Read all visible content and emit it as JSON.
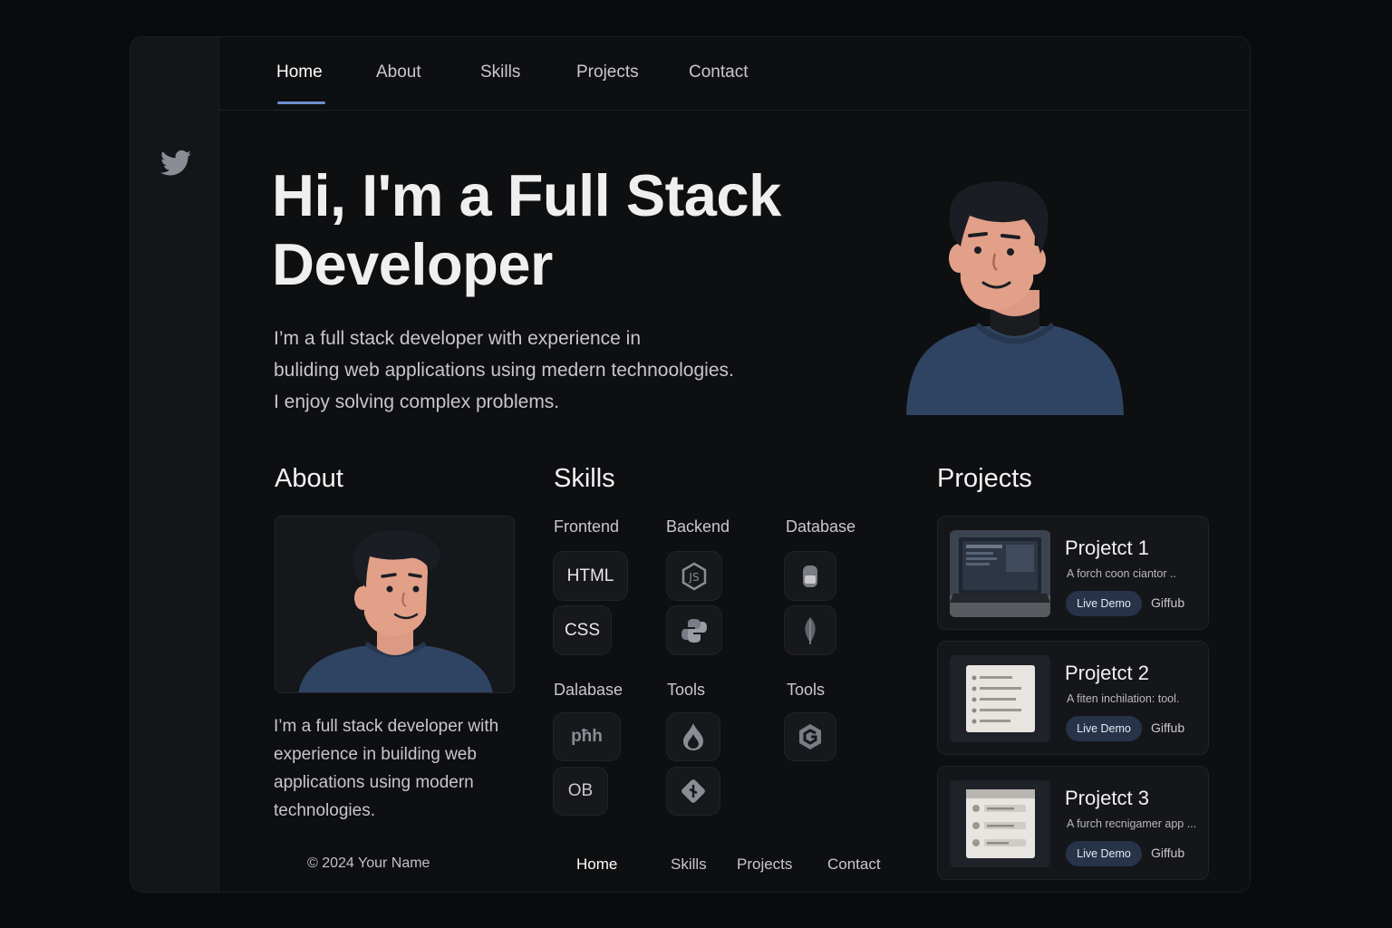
{
  "nav": {
    "items": [
      {
        "label": "Home",
        "active": true
      },
      {
        "label": "About"
      },
      {
        "label": "Skills"
      },
      {
        "label": "Projects"
      },
      {
        "label": "Contact"
      }
    ]
  },
  "sidebar": {
    "icon": "twitter-bird-icon"
  },
  "hero": {
    "title_line1": "Hi, I'm a Full Stack",
    "title_line2": "Developer",
    "desc_line1": "I’m a full stack developer with experience in",
    "desc_line2": "buliding web applications using medern technoologies.",
    "desc_line3": "I enjoy solving complex problems."
  },
  "about": {
    "heading": "About",
    "text": "I’m a full stack developer with experience in building web applications using modern technologies."
  },
  "skills": {
    "heading": "Skills",
    "categories": [
      "Frontend",
      "Backend",
      "Database",
      "Dalabase",
      "Tools",
      "Tools"
    ],
    "chips": {
      "html": "HTML",
      "css": "CSS",
      "ob": "OB",
      "php": "pħh",
      "node_icon": "nodejs-icon",
      "python_icon": "python-icon",
      "db_icon": "database-icon",
      "leaf_icon": "mongodb-leaf-icon",
      "flame_icon": "flame-icon",
      "git_icon": "git-icon",
      "g_icon": "g-logo-icon"
    }
  },
  "projects": {
    "heading": "Projects",
    "items": [
      {
        "title": "Projetct 1",
        "desc": "A forch coon ciantor ..",
        "demo": "Live Demo",
        "repo": "Giffub",
        "thumb": "laptop-thumbnail"
      },
      {
        "title": "Projetct 2",
        "desc": "A fiten inchilation: tool.",
        "demo": "Live Demo",
        "repo": "Giffub",
        "thumb": "checklist-thumbnail"
      },
      {
        "title": "Projetct 3",
        "desc": "A furch recnigamer app ...",
        "demo": "Live Demo",
        "repo": "Giffub",
        "thumb": "form-thumbnail"
      }
    ]
  },
  "footer": {
    "copyright": "© 2024 Your Name",
    "links": [
      {
        "label": "Home",
        "active": true
      },
      {
        "label": "Skills"
      },
      {
        "label": "Projects"
      },
      {
        "label": "Contact"
      }
    ]
  },
  "colors": {
    "background": "#0a0b0d",
    "accent": "#6f8fd0",
    "button": "#263349",
    "shirt": "#2f4462",
    "skin": "#e3a088"
  }
}
